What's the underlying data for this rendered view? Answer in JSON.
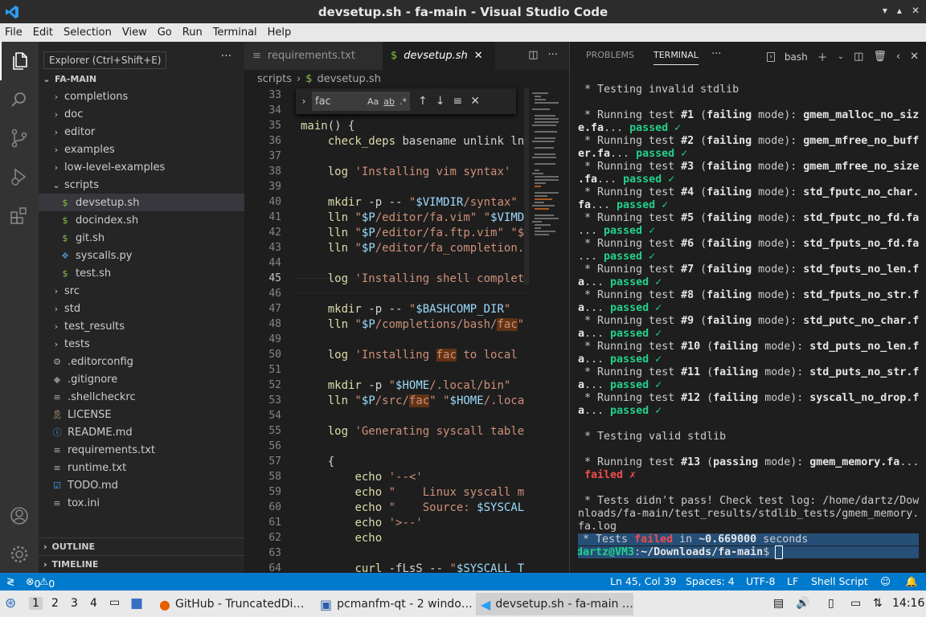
{
  "window": {
    "title": "devsetup.sh - fa-main - Visual Studio Code",
    "controls": [
      "▾",
      "▴",
      "✕"
    ]
  },
  "menu": [
    "File",
    "Edit",
    "Selection",
    "View",
    "Go",
    "Run",
    "Terminal",
    "Help"
  ],
  "activity": [
    "explorer-icon",
    "search-icon",
    "source-control-icon",
    "run-debug-icon",
    "extensions-icon",
    "accounts-icon",
    "manage-gear-icon"
  ],
  "tooltip": "Explorer (Ctrl+Shift+E)",
  "sidebar": {
    "more": "···",
    "root": "FA-MAIN",
    "items": [
      {
        "label": "completions",
        "kind": "folder",
        "open": false
      },
      {
        "label": "doc",
        "kind": "folder",
        "open": false
      },
      {
        "label": "editor",
        "kind": "folder",
        "open": false
      },
      {
        "label": "examples",
        "kind": "folder",
        "open": false
      },
      {
        "label": "low-level-examples",
        "kind": "folder",
        "open": false
      },
      {
        "label": "scripts",
        "kind": "folder",
        "open": true
      },
      {
        "label": "devsetup.sh",
        "kind": "sh",
        "selected": true
      },
      {
        "label": "docindex.sh",
        "kind": "sh"
      },
      {
        "label": "git.sh",
        "kind": "sh"
      },
      {
        "label": "syscalls.py",
        "kind": "py"
      },
      {
        "label": "test.sh",
        "kind": "sh"
      },
      {
        "label": "src",
        "kind": "folder",
        "open": false
      },
      {
        "label": "std",
        "kind": "folder",
        "open": false
      },
      {
        "label": "test_results",
        "kind": "folder",
        "open": false
      },
      {
        "label": "tests",
        "kind": "folder",
        "open": false
      },
      {
        "label": ".editorconfig",
        "kind": "gear"
      },
      {
        "label": ".gitignore",
        "kind": "git"
      },
      {
        "label": ".shellcheckrc",
        "kind": "lines"
      },
      {
        "label": "LICENSE",
        "kind": "license"
      },
      {
        "label": "README.md",
        "kind": "info"
      },
      {
        "label": "requirements.txt",
        "kind": "lines"
      },
      {
        "label": "runtime.txt",
        "kind": "lines"
      },
      {
        "label": "TODO.md",
        "kind": "todo"
      },
      {
        "label": "tox.ini",
        "kind": "lines"
      }
    ],
    "outline": "OUTLINE",
    "timeline": "TIMELINE"
  },
  "editor": {
    "tabs": [
      {
        "label": "requirements.txt",
        "active": false
      },
      {
        "label": "devsetup.sh",
        "active": true
      }
    ],
    "breadcrumb": [
      "scripts",
      "devsetup.sh"
    ],
    "find": {
      "query": "fac",
      "opts": [
        "Aa",
        "ab",
        ".*"
      ]
    },
    "current_line": 45,
    "lines": [
      {
        "n": 33,
        "t": "}"
      },
      {
        "n": 34,
        "t": ""
      },
      {
        "n": 35,
        "t": "main() {"
      },
      {
        "n": 36,
        "t": "    check_deps basename unlink ln"
      },
      {
        "n": 37,
        "t": ""
      },
      {
        "n": 38,
        "t": "    log 'Installing vim syntax'"
      },
      {
        "n": 39,
        "t": ""
      },
      {
        "n": 40,
        "t": "    mkdir -p -- \"$VIMDIR/syntax\""
      },
      {
        "n": 41,
        "t": "    lln \"$P/editor/fa.vim\" \"$VIMD"
      },
      {
        "n": 42,
        "t": "    lln \"$P/editor/fa.ftp.vim\" \"$"
      },
      {
        "n": 43,
        "t": "    lln \"$P/editor/fa_completion."
      },
      {
        "n": 44,
        "t": ""
      },
      {
        "n": 45,
        "t": "    log 'Installing shell complet"
      },
      {
        "n": 46,
        "t": ""
      },
      {
        "n": 47,
        "t": "    mkdir -p -- \"$BASHCOMP_DIR\""
      },
      {
        "n": 48,
        "t": "    lln \"$P/completions/bash/fac\""
      },
      {
        "n": 49,
        "t": ""
      },
      {
        "n": 50,
        "t": "    log 'Installing fac to local"
      },
      {
        "n": 51,
        "t": ""
      },
      {
        "n": 52,
        "t": "    mkdir -p \"$HOME/.local/bin\""
      },
      {
        "n": 53,
        "t": "    lln \"$P/src/fac\" \"$HOME/.loca"
      },
      {
        "n": 54,
        "t": ""
      },
      {
        "n": 55,
        "t": "    log 'Generating syscall table"
      },
      {
        "n": 56,
        "t": ""
      },
      {
        "n": 57,
        "t": "    {"
      },
      {
        "n": 58,
        "t": "        echo '--<'"
      },
      {
        "n": 59,
        "t": "        echo \"    Linux syscall m"
      },
      {
        "n": 60,
        "t": "        echo \"    Source: $SYSCAL"
      },
      {
        "n": 61,
        "t": "        echo '>--'"
      },
      {
        "n": 62,
        "t": "        echo"
      },
      {
        "n": 63,
        "t": ""
      },
      {
        "n": 64,
        "t": "        curl -fLsS -- \"$SYSCALL_T"
      }
    ]
  },
  "panel": {
    "tabs": [
      "PROBLEMS",
      "TERMINAL"
    ],
    "active_tab": "TERMINAL",
    "more": "···",
    "shell": "bash",
    "terminal": [
      [
        [
          "n",
          " * Testing invalid stdlib"
        ]
      ],
      [
        [
          "n",
          ""
        ]
      ],
      [
        [
          "n",
          " * Running test "
        ],
        [
          "b",
          "#1"
        ],
        [
          "n",
          " ("
        ],
        [
          "b",
          "failing"
        ],
        [
          "n",
          " mode): "
        ],
        [
          "b",
          "gmem_malloc_no_siz"
        ]
      ],
      [
        [
          "b",
          "e.fa"
        ],
        [
          "n",
          "... "
        ],
        [
          "g",
          "passed ✓"
        ]
      ],
      [
        [
          "n",
          " * Running test "
        ],
        [
          "b",
          "#2"
        ],
        [
          "n",
          " ("
        ],
        [
          "b",
          "failing"
        ],
        [
          "n",
          " mode): "
        ],
        [
          "b",
          "gmem_mfree_no_buff"
        ]
      ],
      [
        [
          "b",
          "er.fa"
        ],
        [
          "n",
          "... "
        ],
        [
          "g",
          "passed ✓"
        ]
      ],
      [
        [
          "n",
          " * Running test "
        ],
        [
          "b",
          "#3"
        ],
        [
          "n",
          " ("
        ],
        [
          "b",
          "failing"
        ],
        [
          "n",
          " mode): "
        ],
        [
          "b",
          "gmem_mfree_no_size"
        ]
      ],
      [
        [
          "b",
          ".fa"
        ],
        [
          "n",
          "... "
        ],
        [
          "g",
          "passed ✓"
        ]
      ],
      [
        [
          "n",
          " * Running test "
        ],
        [
          "b",
          "#4"
        ],
        [
          "n",
          " ("
        ],
        [
          "b",
          "failing"
        ],
        [
          "n",
          " mode): "
        ],
        [
          "b",
          "std_fputc_no_char."
        ]
      ],
      [
        [
          "b",
          "fa"
        ],
        [
          "n",
          "... "
        ],
        [
          "g",
          "passed ✓"
        ]
      ],
      [
        [
          "n",
          " * Running test "
        ],
        [
          "b",
          "#5"
        ],
        [
          "n",
          " ("
        ],
        [
          "b",
          "failing"
        ],
        [
          "n",
          " mode): "
        ],
        [
          "b",
          "std_fputc_no_fd.fa"
        ]
      ],
      [
        [
          "n",
          "... "
        ],
        [
          "g",
          "passed ✓"
        ]
      ],
      [
        [
          "n",
          " * Running test "
        ],
        [
          "b",
          "#6"
        ],
        [
          "n",
          " ("
        ],
        [
          "b",
          "failing"
        ],
        [
          "n",
          " mode): "
        ],
        [
          "b",
          "std_fputs_no_fd.fa"
        ]
      ],
      [
        [
          "n",
          "... "
        ],
        [
          "g",
          "passed ✓"
        ]
      ],
      [
        [
          "n",
          " * Running test "
        ],
        [
          "b",
          "#7"
        ],
        [
          "n",
          " ("
        ],
        [
          "b",
          "failing"
        ],
        [
          "n",
          " mode): "
        ],
        [
          "b",
          "std_fputs_no_len.f"
        ]
      ],
      [
        [
          "b",
          "a"
        ],
        [
          "n",
          "... "
        ],
        [
          "g",
          "passed ✓"
        ]
      ],
      [
        [
          "n",
          " * Running test "
        ],
        [
          "b",
          "#8"
        ],
        [
          "n",
          " ("
        ],
        [
          "b",
          "failing"
        ],
        [
          "n",
          " mode): "
        ],
        [
          "b",
          "std_fputs_no_str.f"
        ]
      ],
      [
        [
          "b",
          "a"
        ],
        [
          "n",
          "... "
        ],
        [
          "g",
          "passed ✓"
        ]
      ],
      [
        [
          "n",
          " * Running test "
        ],
        [
          "b",
          "#9"
        ],
        [
          "n",
          " ("
        ],
        [
          "b",
          "failing"
        ],
        [
          "n",
          " mode): "
        ],
        [
          "b",
          "std_putc_no_char.f"
        ]
      ],
      [
        [
          "b",
          "a"
        ],
        [
          "n",
          "... "
        ],
        [
          "g",
          "passed ✓"
        ]
      ],
      [
        [
          "n",
          " * Running test "
        ],
        [
          "b",
          "#10"
        ],
        [
          "n",
          " ("
        ],
        [
          "b",
          "failing"
        ],
        [
          "n",
          " mode): "
        ],
        [
          "b",
          "std_puts_no_len.f"
        ]
      ],
      [
        [
          "b",
          "a"
        ],
        [
          "n",
          "... "
        ],
        [
          "g",
          "passed ✓"
        ]
      ],
      [
        [
          "n",
          " * Running test "
        ],
        [
          "b",
          "#11"
        ],
        [
          "n",
          " ("
        ],
        [
          "b",
          "failing"
        ],
        [
          "n",
          " mode): "
        ],
        [
          "b",
          "std_puts_no_str.f"
        ]
      ],
      [
        [
          "b",
          "a"
        ],
        [
          "n",
          "... "
        ],
        [
          "g",
          "passed ✓"
        ]
      ],
      [
        [
          "n",
          " * Running test "
        ],
        [
          "b",
          "#12"
        ],
        [
          "n",
          " ("
        ],
        [
          "b",
          "failing"
        ],
        [
          "n",
          " mode): "
        ],
        [
          "b",
          "syscall_no_drop.f"
        ]
      ],
      [
        [
          "b",
          "a"
        ],
        [
          "n",
          "... "
        ],
        [
          "g",
          "passed ✓"
        ]
      ],
      [
        [
          "n",
          ""
        ]
      ],
      [
        [
          "n",
          " * Testing valid stdlib"
        ]
      ],
      [
        [
          "n",
          ""
        ]
      ],
      [
        [
          "n",
          " * Running test "
        ],
        [
          "b",
          "#13"
        ],
        [
          "n",
          " ("
        ],
        [
          "b",
          "passing"
        ],
        [
          "n",
          " mode): "
        ],
        [
          "b",
          "gmem_memory.fa"
        ],
        [
          "n",
          "..."
        ]
      ],
      [
        [
          "r",
          " failed ✗"
        ]
      ],
      [
        [
          "n",
          ""
        ]
      ],
      [
        [
          "n",
          " * Tests didn't pass! Check test log: /home/dartz/Dow"
        ]
      ],
      [
        [
          "n",
          "nloads/fa-main/test_results/stdlib_tests/gmem_memory."
        ]
      ],
      [
        [
          "n",
          "fa.log"
        ]
      ],
      [
        [
          "n",
          " * Tests "
        ],
        [
          "r",
          "failed"
        ],
        [
          "n",
          " in "
        ],
        [
          "b",
          "~0.669000"
        ],
        [
          "n",
          " seconds"
        ]
      ],
      [
        [
          "g",
          "dartz@VM3"
        ],
        [
          "n",
          ":"
        ],
        [
          "b",
          "~/Downloads/fa-main"
        ],
        [
          "n",
          "$ "
        ]
      ]
    ]
  },
  "status": {
    "remote": "≷",
    "errors": "0",
    "warnings": "0",
    "position": "Ln 45, Col 39",
    "spaces": "Spaces: 4",
    "encoding": "UTF-8",
    "eol": "LF",
    "language": "Shell Script"
  },
  "taskbar": {
    "workspaces": [
      "1",
      "2",
      "3",
      "4"
    ],
    "tasks": [
      {
        "label": "GitHub - TruncatedDi…",
        "icon": "firefox-icon",
        "active": false
      },
      {
        "label": "pcmanfm-qt - 2 windo…",
        "icon": "folder-window-icon",
        "active": false
      },
      {
        "label": "devsetup.sh - fa-main …",
        "icon": "vscode-icon",
        "active": true
      }
    ],
    "clock": "14:16"
  },
  "colors": {
    "accent": "#007acc",
    "passed": "#23d18b",
    "failed": "#f14c4c",
    "find_highlight": "#623315"
  }
}
